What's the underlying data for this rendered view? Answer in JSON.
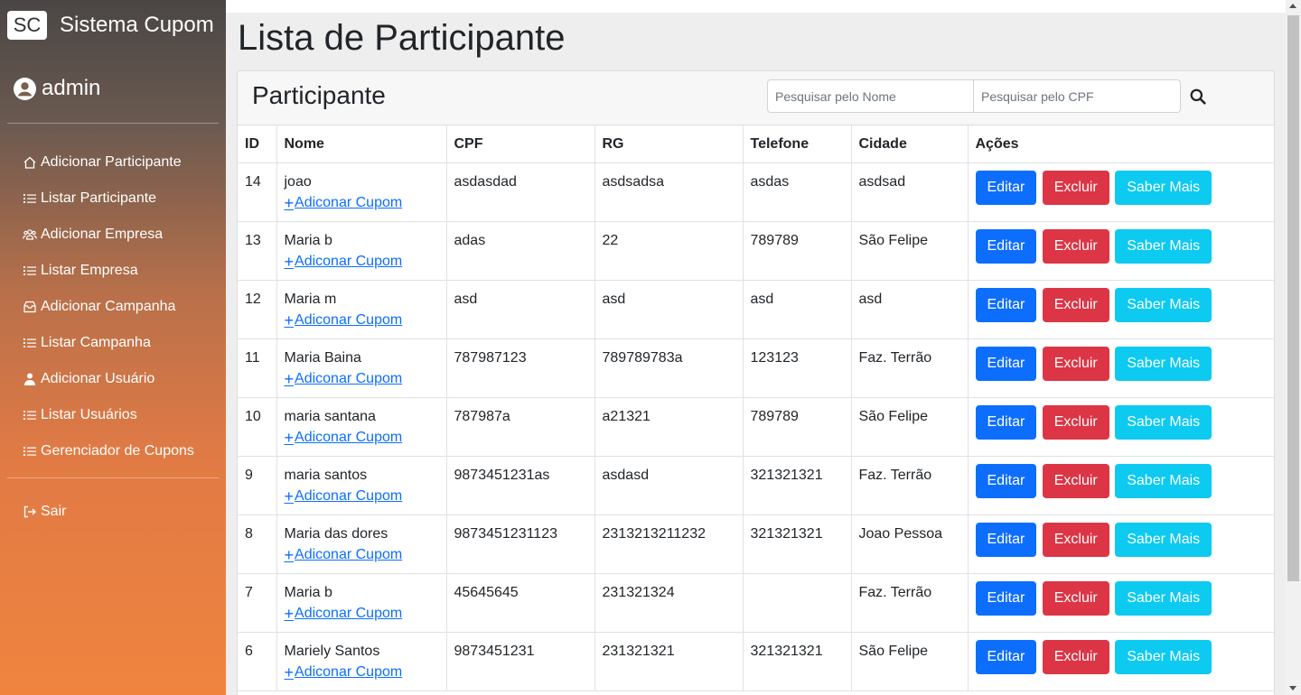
{
  "brand": {
    "logo": "SC",
    "name": "Sistema Cupom"
  },
  "user": {
    "name": "admin",
    "icon": "user-circle-icon"
  },
  "nav": [
    {
      "label": "Adicionar Participante",
      "icon": "home-icon"
    },
    {
      "label": "Listar Participante",
      "icon": "list-icon"
    },
    {
      "label": "Adicionar Empresa",
      "icon": "people-icon"
    },
    {
      "label": "Listar Empresa",
      "icon": "list-icon"
    },
    {
      "label": "Adicionar Campanha",
      "icon": "inbox-icon"
    },
    {
      "label": "Listar Campanha",
      "icon": "list-icon"
    },
    {
      "label": "Adicionar Usuário",
      "icon": "person-icon"
    },
    {
      "label": "Listar Usuários",
      "icon": "list-icon"
    },
    {
      "label": "Gerenciador de Cupons",
      "icon": "list-icon"
    }
  ],
  "logout": {
    "label": "Sair",
    "icon": "logout-icon"
  },
  "page": {
    "title": "Lista de Participante"
  },
  "card": {
    "title": "Participante",
    "search_name_placeholder": "Pesquisar pelo Nome",
    "search_cpf_placeholder": "Pesquisar pelo CPF"
  },
  "table": {
    "headers": [
      "ID",
      "Nome",
      "CPF",
      "RG",
      "Telefone",
      "Cidade",
      "Ações"
    ],
    "add_coupon_label": "Adiconar Cupom",
    "actions": {
      "edit": "Editar",
      "delete": "Excluir",
      "more": "Saber Mais"
    },
    "rows": [
      {
        "id": "14",
        "nome": "joao",
        "cpf": "asdasdad",
        "rg": "asdsadsa",
        "telefone": "asdas",
        "cidade": "asdsad"
      },
      {
        "id": "13",
        "nome": "Maria b",
        "cpf": "adas",
        "rg": "22",
        "telefone": "789789",
        "cidade": "São Felipe"
      },
      {
        "id": "12",
        "nome": "Maria m",
        "cpf": "asd",
        "rg": "asd",
        "telefone": "asd",
        "cidade": "asd"
      },
      {
        "id": "11",
        "nome": "Maria Baina",
        "cpf": "787987123",
        "rg": "789789783a",
        "telefone": "123123",
        "cidade": "Faz. Terrão"
      },
      {
        "id": "10",
        "nome": "maria santana",
        "cpf": "787987a",
        "rg": "a21321",
        "telefone": "789789",
        "cidade": "São Felipe"
      },
      {
        "id": "9",
        "nome": "maria santos",
        "cpf": "9873451231as",
        "rg": "asdasd",
        "telefone": "321321321",
        "cidade": "Faz. Terrão"
      },
      {
        "id": "8",
        "nome": "Maria das dores",
        "cpf": "9873451231123",
        "rg": "2313213211232",
        "telefone": "321321321",
        "cidade": "Joao Pessoa"
      },
      {
        "id": "7",
        "nome": "Maria b",
        "cpf": "45645645",
        "rg": "231321324",
        "telefone": "",
        "cidade": "Faz. Terrão"
      },
      {
        "id": "6",
        "nome": "Mariely Santos",
        "cpf": "9873451231",
        "rg": "231321321",
        "telefone": "321321321",
        "cidade": "São Felipe"
      }
    ]
  },
  "colors": {
    "primary": "#0d6efd",
    "danger": "#dc3545",
    "info": "#0dcaf0",
    "sidebar_top": "#4a4645",
    "sidebar_bottom": "#f0843f"
  }
}
